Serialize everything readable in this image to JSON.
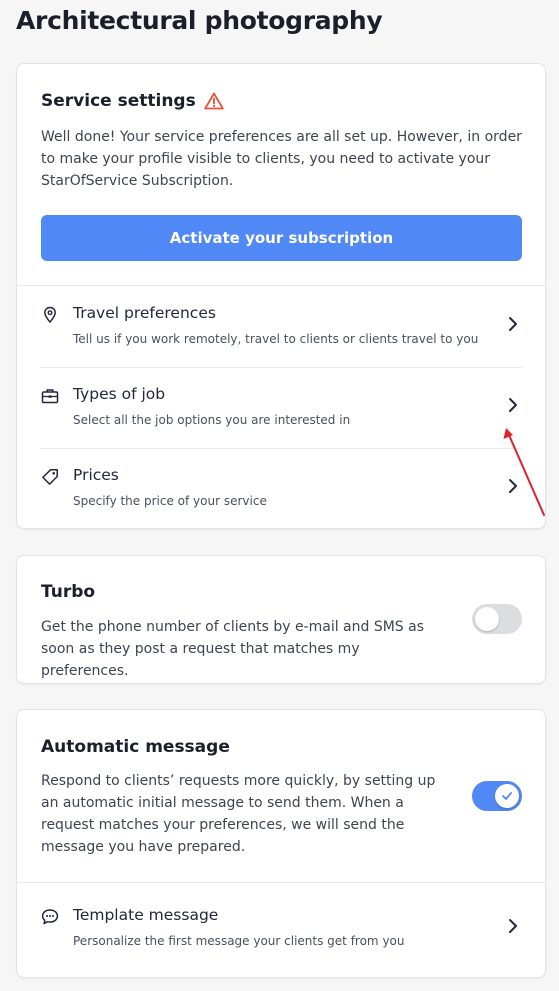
{
  "page": {
    "title": "Architectural photography"
  },
  "service_settings": {
    "title": "Service settings",
    "warning_icon": "warning-triangle-icon",
    "description": "Well done! Your service preferences are all set up. However, in order to make your profile visible to clients, you need to activate your StarOfService Subscription.",
    "cta_label": "Activate your subscription",
    "rows": [
      {
        "icon": "location-pin-icon",
        "title": "Travel preferences",
        "subtitle": "Tell us if you work remotely, travel to clients or clients travel to you"
      },
      {
        "icon": "briefcase-icon",
        "title": "Types of job",
        "subtitle": "Select all the job options you are interested in"
      },
      {
        "icon": "price-tag-icon",
        "title": "Prices",
        "subtitle": "Specify the price of your service"
      }
    ]
  },
  "turbo": {
    "title": "Turbo",
    "description": "Get the phone number of clients by e-mail and SMS as soon as they post a request that matches my preferences.",
    "enabled": false
  },
  "automatic_message": {
    "title": "Automatic message",
    "description": "Respond to clients’ requests more quickly, by setting up an automatic initial message to send them. When a request matches your preferences, we will send the message you have prepared.",
    "enabled": true,
    "template_row": {
      "icon": "chat-bubble-icon",
      "title": "Template message",
      "subtitle": "Personalize the first message your clients get from you"
    }
  },
  "colors": {
    "accent": "#5088f5",
    "warning": "#e5533d",
    "annotation": "#e0202a"
  }
}
